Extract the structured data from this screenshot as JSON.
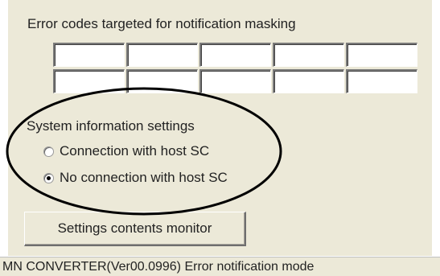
{
  "mask_section": {
    "title": "Error codes targeted for notification masking",
    "codes": [
      [
        "",
        "",
        "",
        "",
        ""
      ],
      [
        "",
        "",
        "",
        "",
        ""
      ]
    ]
  },
  "system_info": {
    "label": "System information settings",
    "options": [
      {
        "label": "Connection with host SC",
        "selected": false
      },
      {
        "label": "No connection with host SC",
        "selected": true
      }
    ]
  },
  "monitor_button": {
    "label": "Settings contents monitor"
  },
  "status_bar": {
    "text": "MN CONVERTER(Ver00.0996) Error notification mode"
  }
}
